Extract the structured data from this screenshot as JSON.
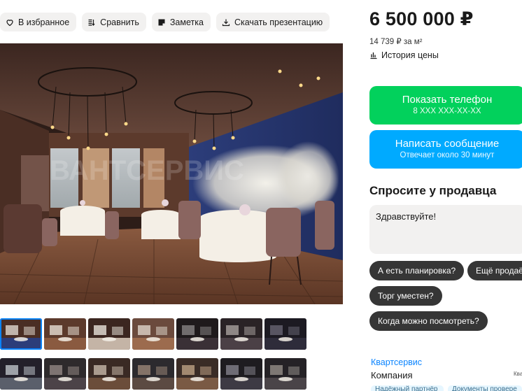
{
  "toolbar": {
    "favorite_label": "В избранное",
    "compare_label": "Сравнить",
    "note_label": "Заметка",
    "download_label": "Скачать презентацию"
  },
  "photo": {
    "watermark": "ВАНТСЕРВИС"
  },
  "thumbnails": {
    "row1_count": 7,
    "row2_count": 7,
    "active_index": 0
  },
  "offer": {
    "price": "6 500 000 ₽",
    "price_per_m2": "14 739 ₽ за м²",
    "price_history_label": "История цены"
  },
  "buttons": {
    "show_phone": "Показать телефон",
    "phone_masked": "8 XXX XXX-XX-XX",
    "write_message": "Написать сообщение",
    "reply_time": "Отвечает около 30 минут"
  },
  "ask": {
    "title": "Спросите у продавца",
    "message_value": "Здравствуйте!",
    "chips": [
      "А есть планировка?",
      "Ещё продаёте?",
      "Торг уместен?",
      "Когда можно посмотреть?"
    ]
  },
  "seller": {
    "name": "Квартсервис",
    "type": "Компания",
    "side_label": "Ква",
    "badges": [
      "Надёжный партнёр",
      "Документы провере"
    ]
  },
  "colors": {
    "green": "#02d15c",
    "blue": "#00aaff",
    "chip": "#363636",
    "link": "#0a84ff"
  }
}
